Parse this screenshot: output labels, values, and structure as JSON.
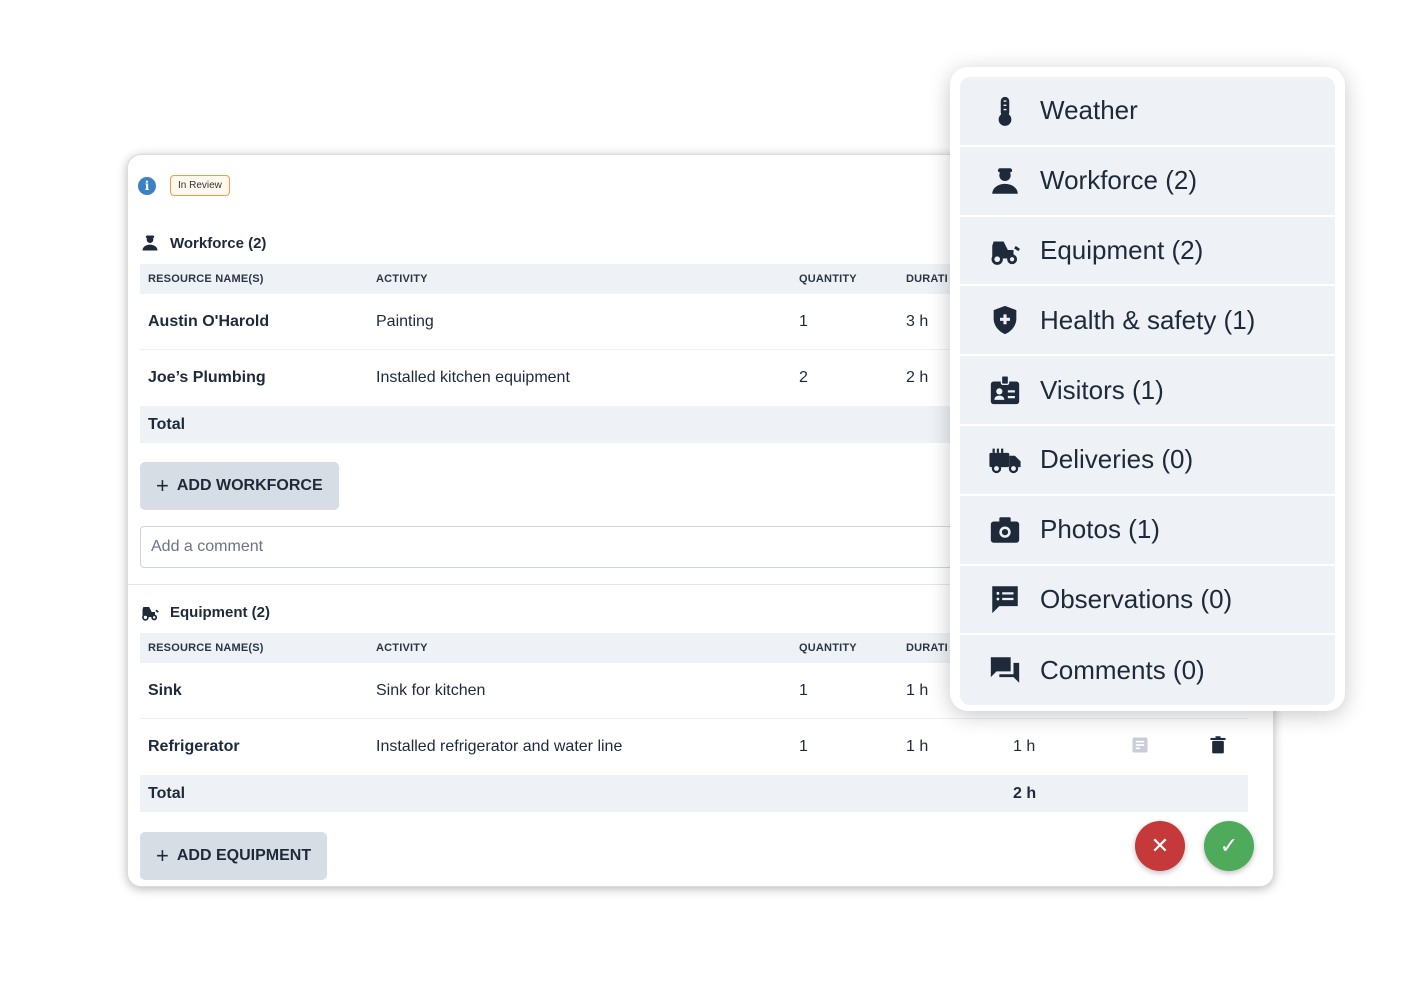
{
  "status": "In Review",
  "workforce": {
    "title": "Workforce (2)",
    "headers": [
      "RESOURCE NAME(S)",
      "ACTIVITY",
      "QUANTITY",
      "DURATI"
    ],
    "rows": [
      {
        "name": "Austin O'Harold",
        "activity": "Painting",
        "quantity": "1",
        "duration": "3 h"
      },
      {
        "name": "Joe’s Plumbing",
        "activity": "Installed kitchen equipment",
        "quantity": "2",
        "duration": "2 h"
      }
    ],
    "total_label": "Total",
    "add_label": "ADD WORKFORCE"
  },
  "comment": {
    "placeholder": "Add a comment"
  },
  "equipment": {
    "title": "Equipment (2)",
    "headers": [
      "RESOURCE NAME(S)",
      "ACTIVITY",
      "QUANTITY",
      "DURATI"
    ],
    "rows": [
      {
        "name": "Sink",
        "activity": "Sink for kitchen",
        "quantity": "1",
        "duration": "1 h"
      },
      {
        "name": "Refrigerator",
        "activity": "Installed refrigerator and water line",
        "quantity": "1",
        "duration": "1 h",
        "total": "1 h"
      }
    ],
    "total_label": "Total",
    "total_value": "2 h",
    "add_label": "ADD EQUIPMENT"
  },
  "actions": {
    "cancel": "✕",
    "confirm": "✓"
  },
  "menu": {
    "items": [
      {
        "label": "Weather",
        "icon": "thermometer-icon"
      },
      {
        "label": "Workforce (2)",
        "icon": "worker-icon"
      },
      {
        "label": "Equipment (2)",
        "icon": "tractor-icon"
      },
      {
        "label": "Health & safety (1)",
        "icon": "shield-plus-icon"
      },
      {
        "label": "Visitors (1)",
        "icon": "badge-icon"
      },
      {
        "label": "Deliveries (0)",
        "icon": "truck-icon"
      },
      {
        "label": "Photos (1)",
        "icon": "camera-icon"
      },
      {
        "label": "Observations (0)",
        "icon": "message-list-icon"
      },
      {
        "label": "Comments (0)",
        "icon": "comments-icon"
      }
    ]
  },
  "colors": {
    "accent": "#1e2a3a",
    "cancel": "#c6393a",
    "confirm": "#4faa5c",
    "badge_border": "#e9a04a"
  }
}
